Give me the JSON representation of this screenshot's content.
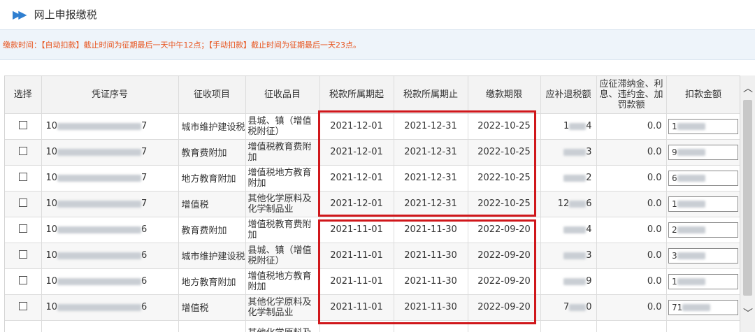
{
  "header": {
    "arrow_icon": "double-chevron-right-icon",
    "title": "网上申报缴税"
  },
  "notice": "缴款时间：【自动扣款】截止时间为征期最后一天中午12点；【手动扣款】截止时间为征期最后一天23点。",
  "table": {
    "columns": [
      "选择",
      "凭证序号",
      "征收项目",
      "征收品目",
      "税款所属期起",
      "税款所属期止",
      "缴款期限",
      "应补退税额",
      "应征滞纳金、利息、违约金、加罚款额",
      "扣款金额"
    ],
    "rows": [
      {
        "voucher_prefix": "10",
        "voucher_suffix": "7",
        "project": "城市维护建设税",
        "item": "县城、镇（增值税附征）",
        "start": "2021-12-01",
        "end": "2021-12-31",
        "deadline": "2022-10-25",
        "tax_prefix": "1",
        "tax_suffix": "4",
        "penalty": "0.0",
        "amount_prefix": "1"
      },
      {
        "voucher_prefix": "10",
        "voucher_suffix": "7",
        "project": "教育费附加",
        "item": "增值税教育费附加",
        "start": "2021-12-01",
        "end": "2021-12-31",
        "deadline": "2022-10-25",
        "tax_prefix": "",
        "tax_suffix": "3",
        "penalty": "0.0",
        "amount_prefix": "9"
      },
      {
        "voucher_prefix": "10",
        "voucher_suffix": "7",
        "project": "地方教育附加",
        "item": "增值税地方教育附加",
        "start": "2021-12-01",
        "end": "2021-12-31",
        "deadline": "2022-10-25",
        "tax_prefix": "",
        "tax_suffix": "2",
        "penalty": "0.0",
        "amount_prefix": "6"
      },
      {
        "voucher_prefix": "10",
        "voucher_suffix": "7",
        "project": "增值税",
        "item": "其他化学原料及化学制品业",
        "start": "2021-12-01",
        "end": "2021-12-31",
        "deadline": "2022-10-25",
        "tax_prefix": "12",
        "tax_suffix": "6",
        "penalty": "0.0",
        "amount_prefix": "1"
      },
      {
        "voucher_prefix": "10",
        "voucher_suffix": "6",
        "project": "教育费附加",
        "item": "增值税教育费附加",
        "start": "2021-11-01",
        "end": "2021-11-30",
        "deadline": "2022-09-20",
        "tax_prefix": "",
        "tax_suffix": "4",
        "penalty": "0.0",
        "amount_prefix": "2"
      },
      {
        "voucher_prefix": "10",
        "voucher_suffix": "6",
        "project": "城市维护建设税",
        "item": "县城、镇（增值税附征）",
        "start": "2021-11-01",
        "end": "2021-11-30",
        "deadline": "2022-09-20",
        "tax_prefix": "",
        "tax_suffix": "3",
        "penalty": "0.0",
        "amount_prefix": "3"
      },
      {
        "voucher_prefix": "10",
        "voucher_suffix": "6",
        "project": "地方教育附加",
        "item": "增值税地方教育附加",
        "start": "2021-11-01",
        "end": "2021-11-30",
        "deadline": "2022-09-20",
        "tax_prefix": "",
        "tax_suffix": "9",
        "penalty": "0.0",
        "amount_prefix": "1"
      },
      {
        "voucher_prefix": "10",
        "voucher_suffix": "6",
        "project": "增值税",
        "item": "其他化学原料及化学制品业",
        "start": "2021-11-01",
        "end": "2021-11-30",
        "deadline": "2022-09-20",
        "tax_prefix": "7",
        "tax_suffix": "0",
        "penalty": "0.0",
        "amount_prefix": "71"
      }
    ],
    "partial_row_item": "其他化学原料及"
  },
  "highlight_color": "#d0171b",
  "accent_color": "#2f7fd0",
  "notice_color": "#e8541e"
}
